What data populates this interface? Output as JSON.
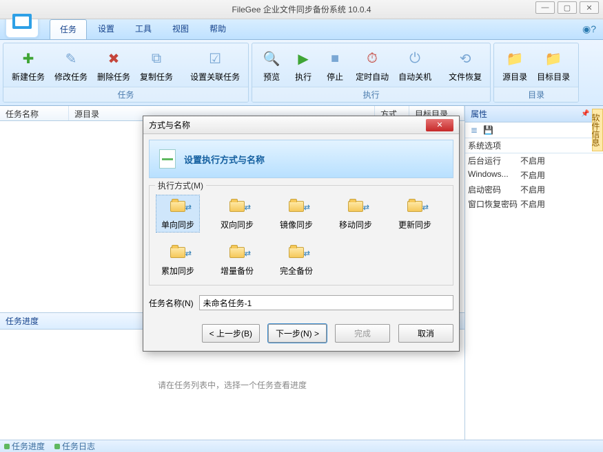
{
  "window": {
    "title": "FileGee 企业文件同步备份系统 10.0.4"
  },
  "menu": {
    "tabs": [
      "任务",
      "设置",
      "工具",
      "视图",
      "帮助"
    ],
    "active": 0
  },
  "ribbon": {
    "groups": [
      {
        "label": "任务",
        "buttons": [
          {
            "name": "new-task",
            "label": "新建任务",
            "glyph": "✚",
            "color": "#3fa536"
          },
          {
            "name": "edit-task",
            "label": "修改任务",
            "glyph": "✎",
            "color": "#7aa7d4"
          },
          {
            "name": "delete-task",
            "label": "删除任务",
            "glyph": "✖",
            "color": "#c4453b"
          },
          {
            "name": "copy-task",
            "label": "复制任务",
            "glyph": "⧉",
            "color": "#7aa7d4"
          },
          {
            "name": "set-related",
            "label": "设置关联任务",
            "glyph": "☑",
            "color": "#7aa7d4"
          }
        ]
      },
      {
        "label": "执行",
        "buttons": [
          {
            "name": "preview",
            "label": "预览",
            "glyph": "🔍",
            "color": "#7aa7d4"
          },
          {
            "name": "run",
            "label": "执行",
            "glyph": "▶",
            "color": "#3fa536"
          },
          {
            "name": "stop",
            "label": "停止",
            "glyph": "■",
            "color": "#7aa7d4"
          },
          {
            "name": "timer",
            "label": "定时自动",
            "glyph": "⏱",
            "color": "#c4453b"
          },
          {
            "name": "shutdown",
            "label": "自动关机",
            "glyph": "⏻",
            "color": "#7aa7d4"
          },
          {
            "name": "restore",
            "label": "文件恢复",
            "glyph": "⟲",
            "color": "#7aa7d4"
          }
        ]
      },
      {
        "label": "目录",
        "buttons": [
          {
            "name": "src-dir",
            "label": "源目录",
            "glyph": "📁",
            "color": "#e2b23a"
          },
          {
            "name": "dst-dir",
            "label": "目标目录",
            "glyph": "📁",
            "color": "#e2b23a"
          }
        ]
      }
    ]
  },
  "taskList": {
    "columns": [
      "任务名称",
      "源目录",
      "方式",
      "目标目录"
    ]
  },
  "progressPanel": {
    "title": "任务进度",
    "placeholder": "请在任务列表中，选择一个任务查看进度"
  },
  "propsPanel": {
    "title": "属性",
    "sectionLabel": "系统选项",
    "rows": [
      {
        "k": "后台运行",
        "v": "不启用"
      },
      {
        "k": "Windows...",
        "v": "不启用"
      },
      {
        "k": "启动密码",
        "v": "不启用"
      },
      {
        "k": "窗口恢复密码",
        "v": "不启用"
      }
    ]
  },
  "sideTab": {
    "label": "软件信息"
  },
  "statusbar": {
    "items": [
      "任务进度",
      "任务日志"
    ]
  },
  "dialog": {
    "title": "方式与名称",
    "banner": "设置执行方式与名称",
    "sectionLabel": "执行方式(M)",
    "modes": [
      {
        "name": "oneway-sync",
        "label": "单向同步",
        "selected": true
      },
      {
        "name": "twoway-sync",
        "label": "双向同步"
      },
      {
        "name": "mirror-sync",
        "label": "镜像同步"
      },
      {
        "name": "move-sync",
        "label": "移动同步"
      },
      {
        "name": "update-sync",
        "label": "更新同步"
      },
      {
        "name": "accum-sync",
        "label": "累加同步"
      },
      {
        "name": "incr-backup",
        "label": "增量备份"
      },
      {
        "name": "full-backup",
        "label": "完全备份"
      }
    ],
    "taskNameLabel": "任务名称(N)",
    "taskNameValue": "未命名任务-1",
    "buttons": {
      "prev": "< 上一步(B)",
      "next": "下一步(N) >",
      "finish": "完成",
      "cancel": "取消"
    }
  }
}
